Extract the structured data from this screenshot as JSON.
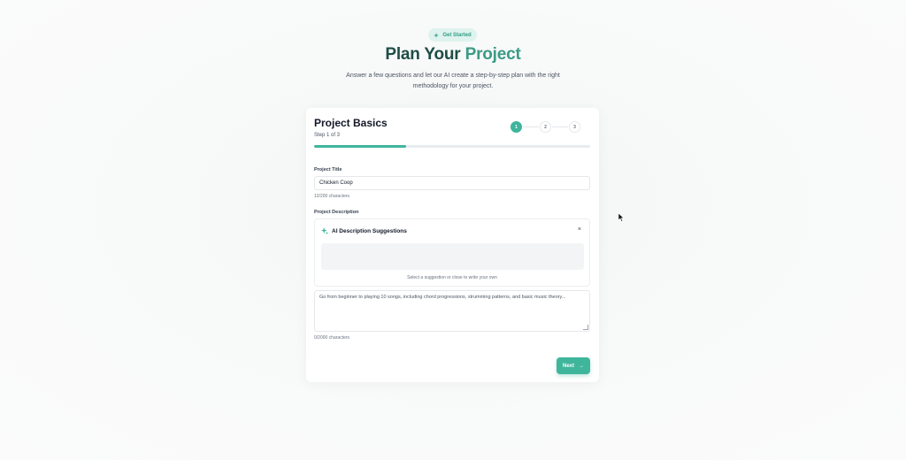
{
  "header": {
    "badge": "Get Started",
    "title_main": "Plan Your ",
    "title_accent": "Project",
    "subtitle": "Answer a few questions and let our AI create a step-by-step plan with the right methodology for your project."
  },
  "card": {
    "title": "Project Basics",
    "step_text": "Step 1 of 3",
    "steps": [
      "1",
      "2",
      "3"
    ],
    "current_step": 1,
    "progress_fraction": 0.333
  },
  "form": {
    "title_label": "Project Title",
    "title_value": "Chicken Coop",
    "title_counter": "12/200 characters",
    "description_label": "Project Description",
    "suggestions": {
      "heading": "AI Description Suggestions",
      "close": "×",
      "note": "Select a suggestion or close to write your own"
    },
    "description_placeholder": "Go from beginner to playing 10 songs, including chord progressions, strumming patterns, and basic music theory...",
    "description_counter": "0/2000 characters",
    "next_label": "Next",
    "next_arrow": "→"
  },
  "colors": {
    "accent": "#3fb59c",
    "title_dark": "#1e4d45",
    "title_accent": "#3a9b86",
    "badge_bg": "#dff3ee"
  },
  "icons": [
    "sparkle-icon",
    "close-icon",
    "arrow-right-icon",
    "mouse-cursor-icon"
  ]
}
